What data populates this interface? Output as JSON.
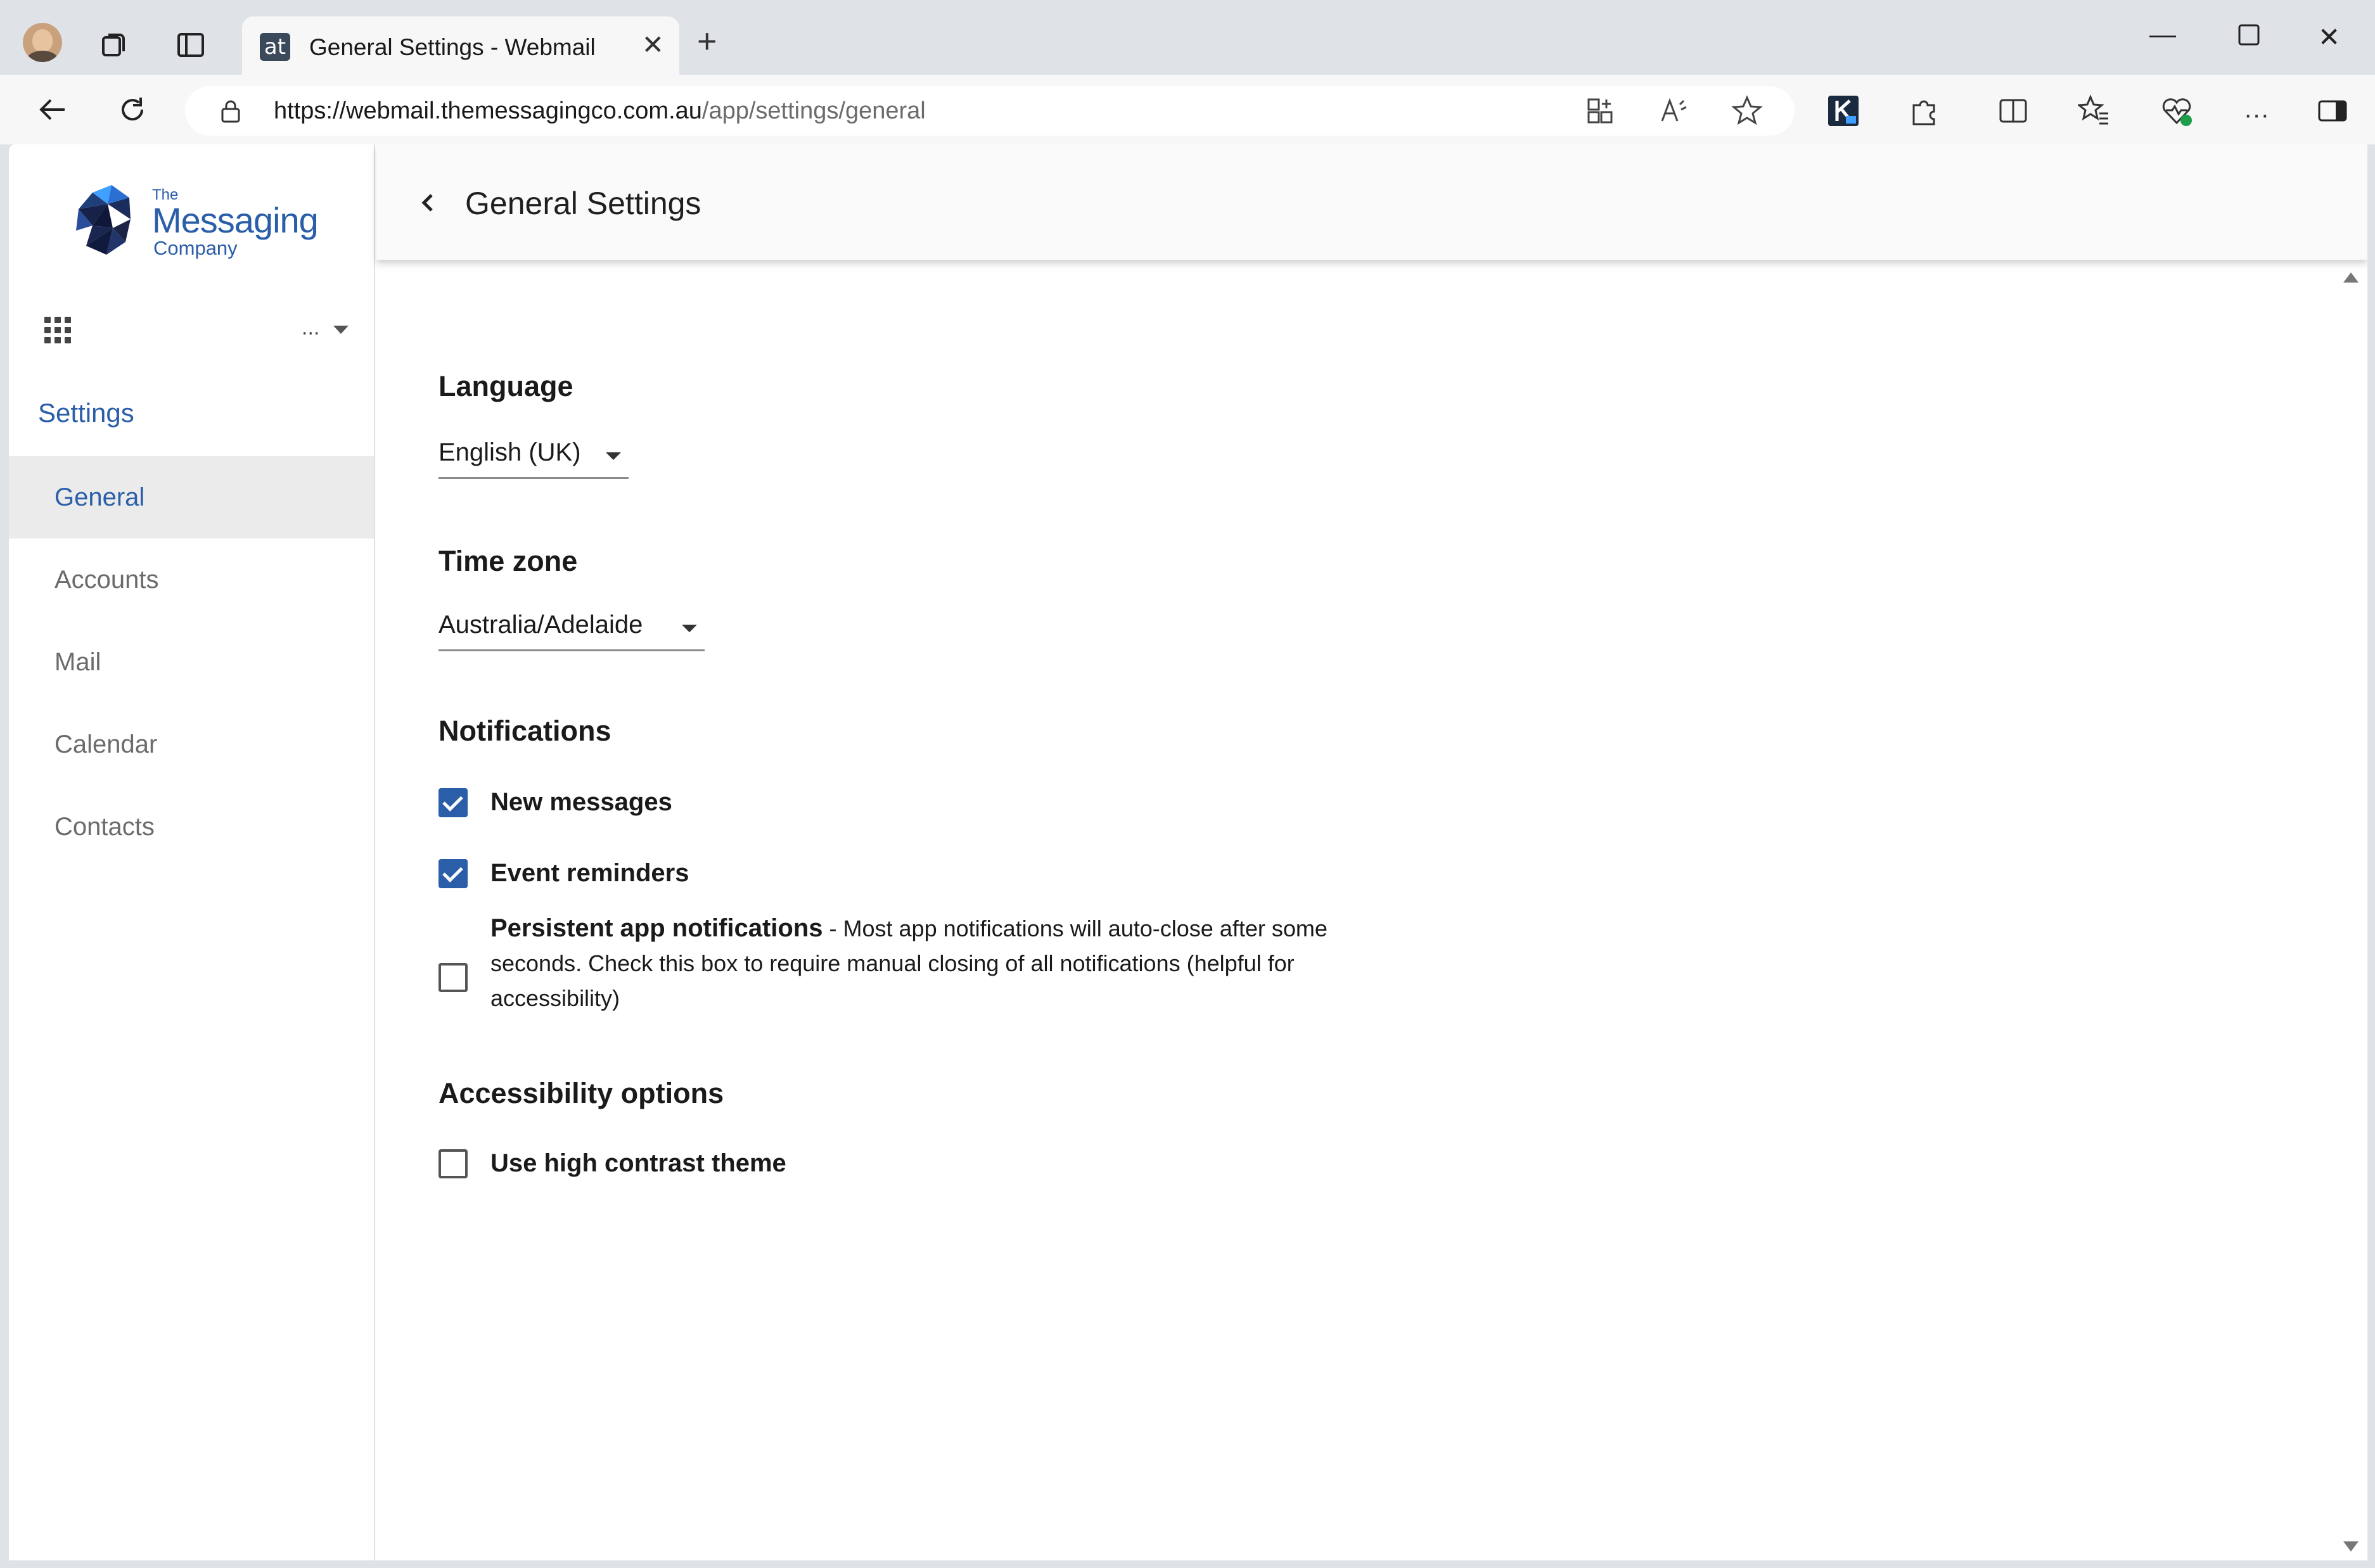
{
  "browser": {
    "tab_title": "General Settings - Webmail",
    "tab_favicon_text": "at",
    "url_host": "https://webmail.themessagingco.com.au",
    "url_path": "/app/settings/general",
    "icons": [
      "profile-avatar",
      "workspaces-icon",
      "tab-actions-icon",
      "close-tab-icon",
      "new-tab-icon",
      "minimize-icon",
      "maximize-icon",
      "close-window-icon",
      "back-arrow-icon",
      "refresh-icon",
      "lock-icon",
      "app-available-icon",
      "read-aloud-icon",
      "favorite-star-icon",
      "extension-k-icon",
      "extensions-puzzle-icon",
      "split-screen-icon",
      "favorites-icon",
      "browser-essentials-icon",
      "more-menu-icon",
      "sidebar-toggle-icon"
    ]
  },
  "sidebar": {
    "logo": {
      "the": "The",
      "main": "Messaging",
      "sub": "Company"
    },
    "account_more": "...",
    "settings_heading": "Settings",
    "items": [
      {
        "label": "General",
        "active": true
      },
      {
        "label": "Accounts",
        "active": false
      },
      {
        "label": "Mail",
        "active": false
      },
      {
        "label": "Calendar",
        "active": false
      },
      {
        "label": "Contacts",
        "active": false
      }
    ]
  },
  "main": {
    "title": "General Settings",
    "language": {
      "heading": "Language",
      "value": "English (UK)"
    },
    "timezone": {
      "heading": "Time zone",
      "value": "Australia/Adelaide"
    },
    "notifications": {
      "heading": "Notifications",
      "new_messages": {
        "label": "New messages",
        "checked": true
      },
      "event_reminders": {
        "label": "Event reminders",
        "checked": true
      },
      "persistent": {
        "label": "Persistent app notifications",
        "description": " - Most app notifications will auto-close after some seconds. Check this box to require manual closing of all notifications (helpful for accessibility)",
        "checked": false
      }
    },
    "accessibility": {
      "heading": "Accessibility options",
      "high_contrast": {
        "label": "Use high contrast theme",
        "checked": false
      }
    }
  },
  "colors": {
    "accent": "#2a5ea8",
    "active_nav_bg": "#ebebeb",
    "chrome_bg": "#dfe3e8"
  }
}
